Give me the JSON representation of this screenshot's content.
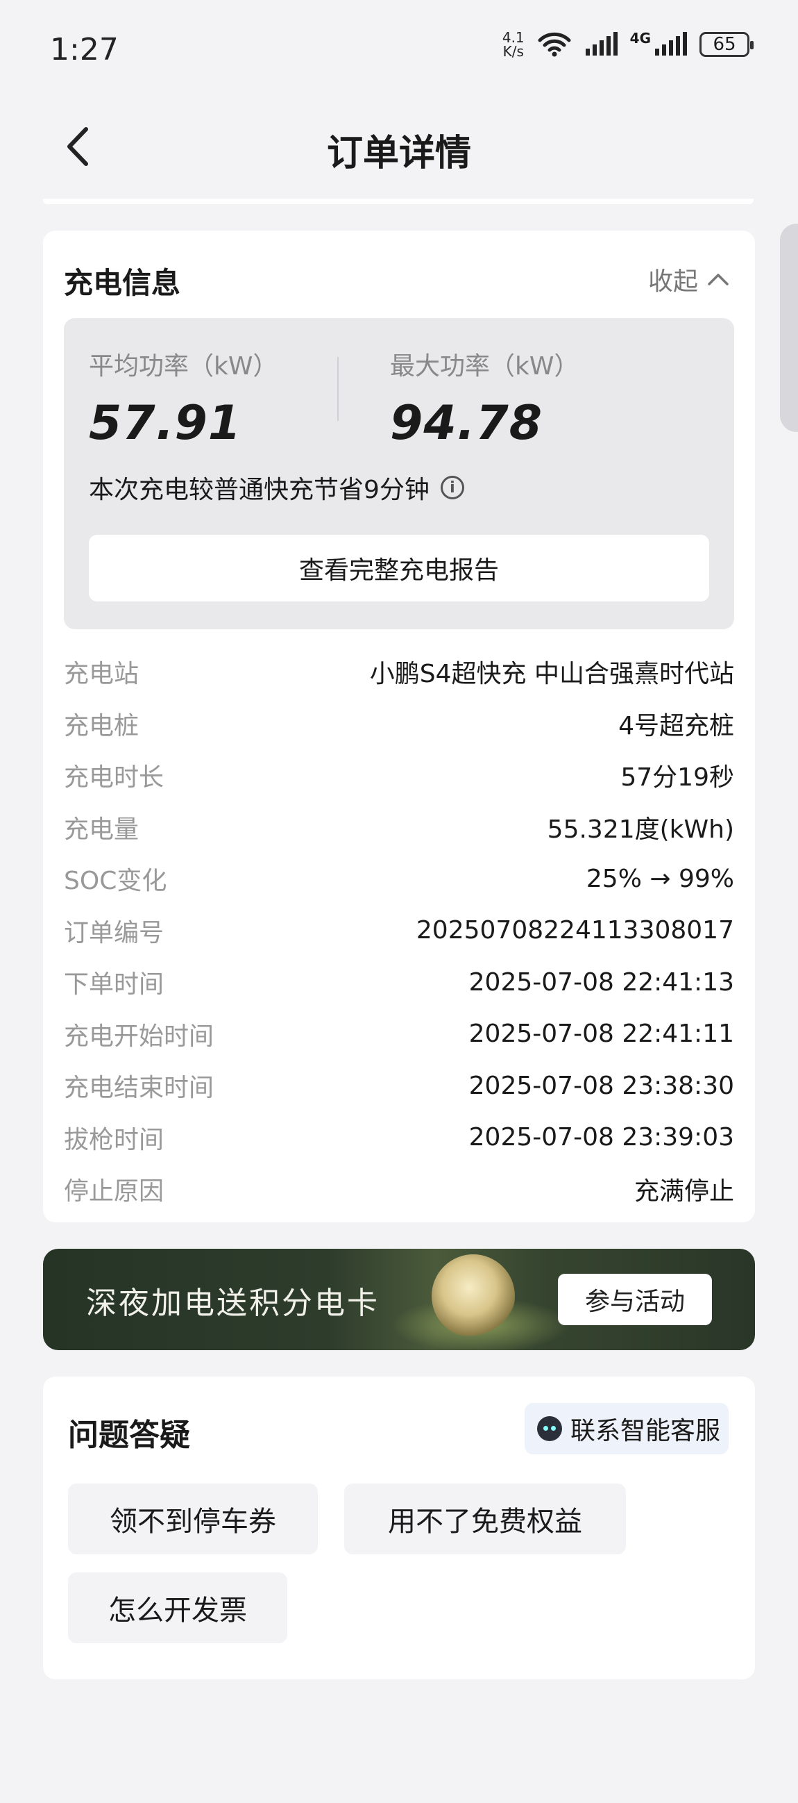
{
  "status_bar": {
    "time": "1:27",
    "net_speed_value": "4.1",
    "net_speed_unit": "K/s",
    "network": "4G",
    "battery": "65"
  },
  "nav": {
    "title": "订单详情"
  },
  "charge_info": {
    "title": "充电信息",
    "collapse_label": "收起",
    "avg_power_label": "平均功率（kW）",
    "avg_power_value": "57.91",
    "max_power_label": "最大功率（kW）",
    "max_power_value": "94.78",
    "saving_text": "本次充电较普通快充节省9分钟",
    "report_button": "查看完整充电报告",
    "details": [
      {
        "key": "充电站",
        "value": "小鹏S4超快充 中山合强熹时代站"
      },
      {
        "key": "充电桩",
        "value": "4号超充桩"
      },
      {
        "key": "充电时长",
        "value": "57分19秒"
      },
      {
        "key": "充电量",
        "value": "55.321度(kWh)"
      },
      {
        "key": "SOC变化",
        "value": "25% → 99%"
      },
      {
        "key": "订单编号",
        "value": "20250708224113308017"
      },
      {
        "key": "下单时间",
        "value": "2025-07-08 22:41:13"
      },
      {
        "key": "充电开始时间",
        "value": "2025-07-08 22:41:11"
      },
      {
        "key": "充电结束时间",
        "value": "2025-07-08 23:38:30"
      },
      {
        "key": "拔枪时间",
        "value": "2025-07-08 23:39:03"
      },
      {
        "key": "停止原因",
        "value": "充满停止"
      }
    ]
  },
  "banner": {
    "text": "深夜加电送积分电卡",
    "button": "参与活动"
  },
  "qa": {
    "title": "问题答疑",
    "service_button": "联系智能客服",
    "chips": [
      "领不到停车券",
      "用不了免费权益",
      "怎么开发票"
    ]
  }
}
